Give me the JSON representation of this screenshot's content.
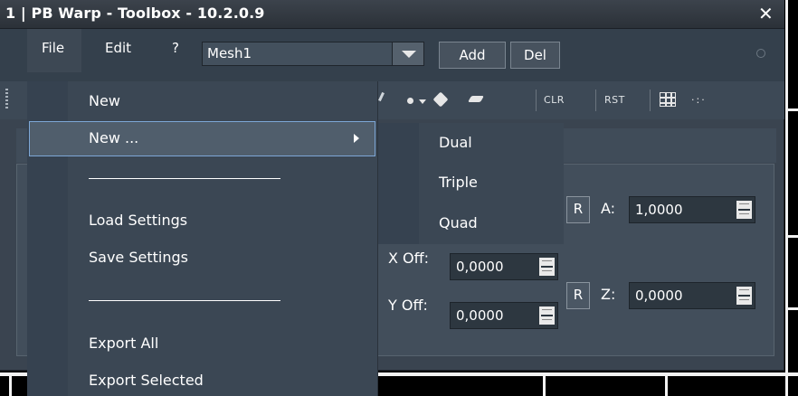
{
  "window": {
    "title": "1 | PB Warp - Toolbox - 10.2.0.9",
    "close_glyph": "✕"
  },
  "menubar": {
    "file": "File",
    "edit": "Edit",
    "help": "?",
    "mesh_select_value": "Mesh1",
    "add_label": "Add",
    "del_label": "Del"
  },
  "toolbar": {
    "clr": "CLR",
    "rst": "RST"
  },
  "panel": {
    "r_label": "R",
    "a_label": "A:",
    "a_value": "1,0000",
    "z_label": "Z:",
    "z_value": "0,0000",
    "xoff_label": "X Off:",
    "xoff_value": "0,0000",
    "yoff_label": "Y Off:",
    "yoff_value": "0,0000"
  },
  "file_menu": {
    "items": [
      {
        "label": "New"
      },
      {
        "label": "New ..."
      },
      {
        "label": "Load Settings"
      },
      {
        "label": "Save Settings"
      },
      {
        "label": "Export All"
      },
      {
        "label": "Export Selected"
      }
    ]
  },
  "submenu": {
    "items": [
      {
        "label": "Dual"
      },
      {
        "label": "Triple"
      },
      {
        "label": "Quad"
      }
    ]
  },
  "colors": {
    "window_bg": "#3a4450",
    "menu_bg": "#3b4754",
    "highlight_border": "#7da7d6",
    "background_scene": "#000000",
    "wireframe": "#f2f2f2"
  }
}
